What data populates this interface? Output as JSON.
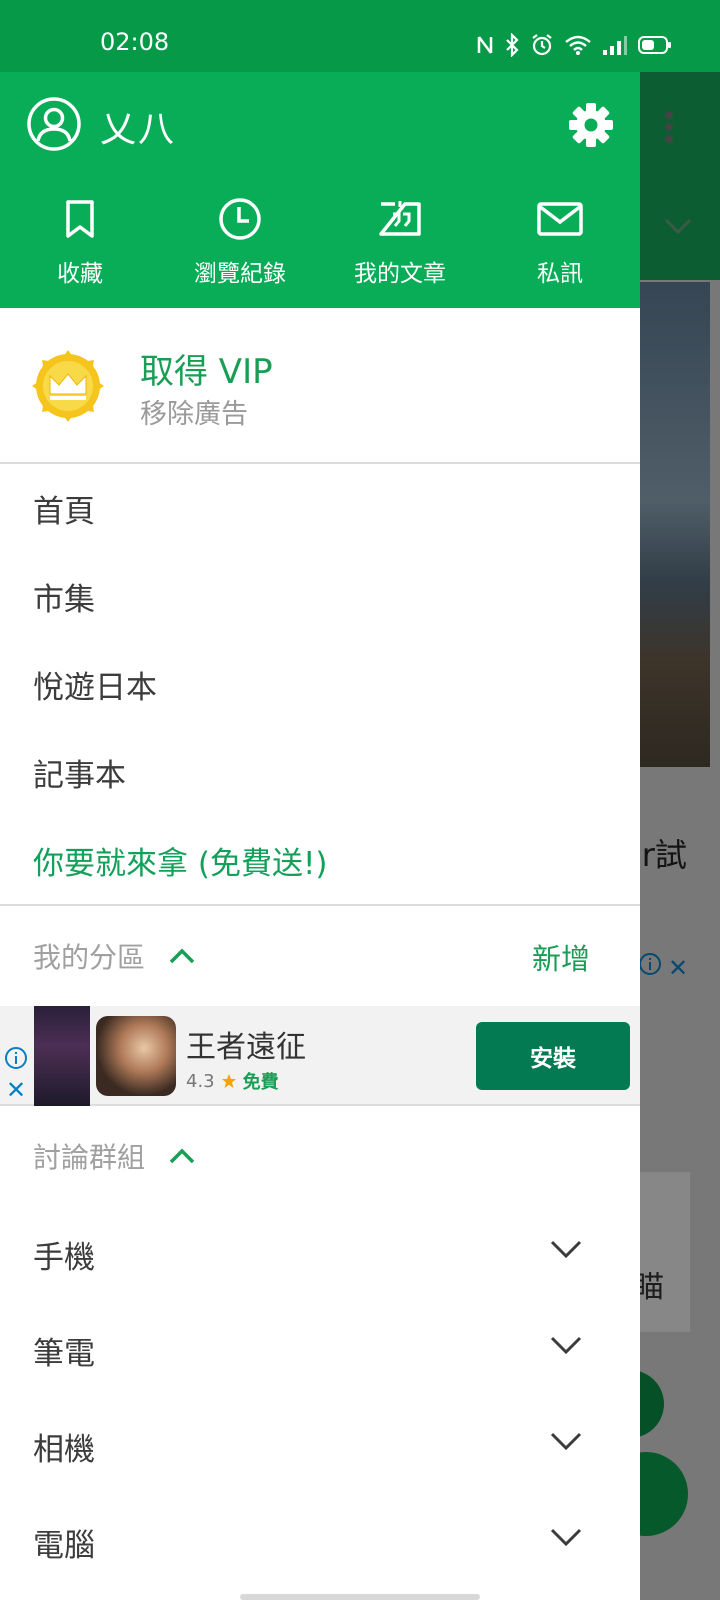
{
  "status_bar": {
    "time": "02:08"
  },
  "drawer": {
    "user": {
      "name": "乂八"
    },
    "shortcuts": [
      {
        "label": "收藏",
        "icon": "bookmark-icon"
      },
      {
        "label": "瀏覽紀錄",
        "icon": "clock-icon"
      },
      {
        "label": "我的文章",
        "icon": "article-icon"
      },
      {
        "label": "私訊",
        "icon": "mail-icon"
      }
    ],
    "vip": {
      "title": "取得 VIP",
      "subtitle": "移除廣告"
    },
    "menu": [
      {
        "label": "首頁"
      },
      {
        "label": "市集"
      },
      {
        "label": "悅遊日本"
      },
      {
        "label": "記事本"
      },
      {
        "label": "你要就來拿 (免費送!)"
      }
    ],
    "my_sections": {
      "title": "我的分區",
      "add_label": "新增"
    },
    "ad": {
      "app_name": "王者遠征",
      "rating": "4.3",
      "price": "免費",
      "install_label": "安裝"
    },
    "groups": {
      "title": "討論群組",
      "items": [
        {
          "label": "手機"
        },
        {
          "label": "筆電"
        },
        {
          "label": "相機"
        },
        {
          "label": "電腦"
        }
      ]
    }
  },
  "background": {
    "text_fragment": "er試",
    "card_fragment": "瞄"
  },
  "colors": {
    "primary": "#0aad57",
    "status_bar": "#069a48",
    "accent_text": "#1a9e55",
    "install_button": "#047a52",
    "vip_gold": "#f5c51d"
  }
}
